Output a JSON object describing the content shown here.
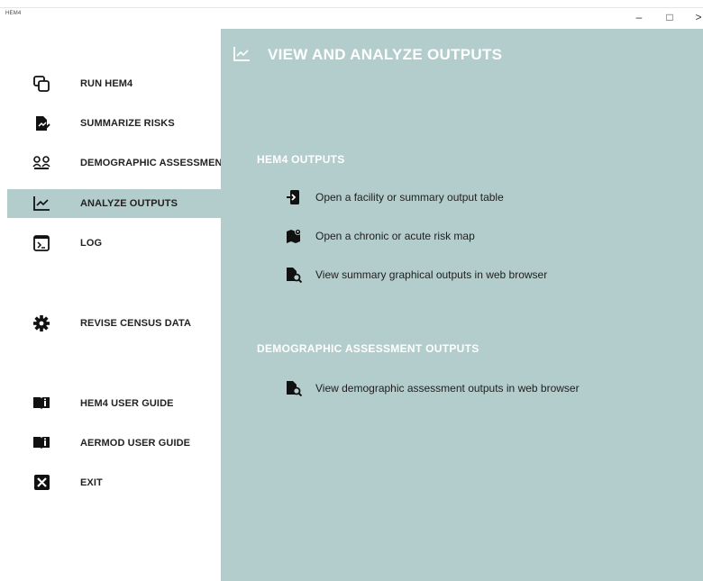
{
  "window": {
    "title": "HEM4",
    "minimize": "–",
    "maximize": "□",
    "close": ">"
  },
  "sidebar": {
    "items": [
      {
        "label": "RUN HEM4",
        "icon": "copy-windows-icon"
      },
      {
        "label": "SUMMARIZE RISKS",
        "icon": "document-edit-icon"
      },
      {
        "label": "DEMOGRAPHIC ASSESSMENT",
        "icon": "people-group-icon"
      },
      {
        "label": "ANALYZE OUTPUTS",
        "icon": "line-chart-icon",
        "active": true
      },
      {
        "label": "LOG",
        "icon": "terminal-icon"
      },
      {
        "label": "REVISE CENSUS DATA",
        "icon": "gear-icon"
      },
      {
        "label": "HEM4 USER GUIDE",
        "icon": "book-icon"
      },
      {
        "label": "AERMOD USER GUIDE",
        "icon": "book-icon"
      },
      {
        "label": "EXIT",
        "icon": "close-box-icon"
      }
    ]
  },
  "main": {
    "title": "VIEW AND ANALYZE OUTPUTS",
    "sections": [
      {
        "title": "HEM4 OUTPUTS",
        "actions": [
          {
            "label": "Open a facility or summary output table",
            "icon": "open-file-icon"
          },
          {
            "label": "Open a chronic or acute risk map",
            "icon": "map-pin-icon"
          },
          {
            "label": "View summary graphical outputs in web browser",
            "icon": "file-search-icon"
          }
        ]
      },
      {
        "title": "DEMOGRAPHIC ASSESSMENT OUTPUTS",
        "actions": [
          {
            "label": "View demographic assessment outputs in web browser",
            "icon": "file-search-icon"
          }
        ]
      }
    ]
  },
  "colors": {
    "panel": "#b3cdcc",
    "active_item": "#b3cdcc",
    "heading_text": "#ffffff"
  }
}
